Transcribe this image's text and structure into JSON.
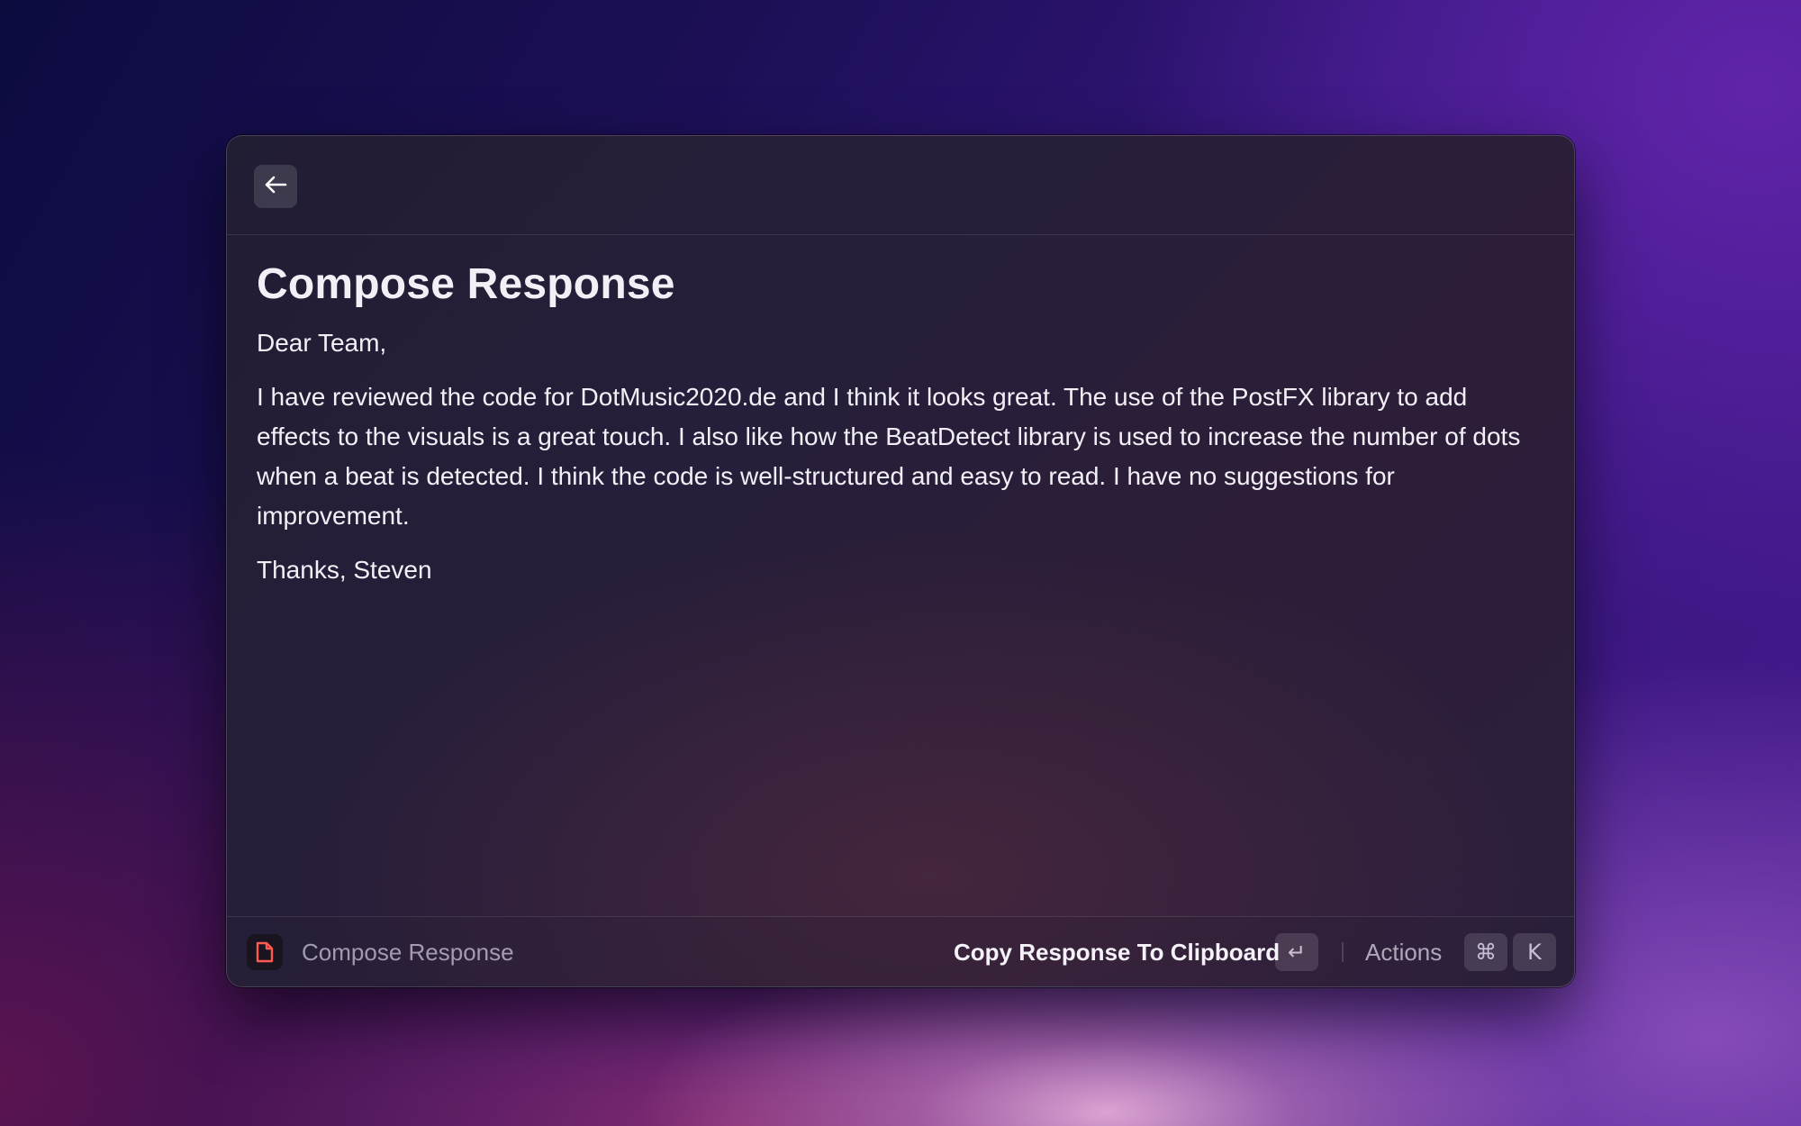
{
  "header": {
    "back_icon": "arrow-left-icon"
  },
  "content": {
    "title": "Compose Response",
    "greeting": "Dear Team,",
    "body": "I have reviewed the code for DotMusic2020.de and I think it looks great. The use of the PostFX library to add effects to the visuals is a great touch. I also like how the BeatDetect library is used to increase the number of dots when a beat is detected. I think the code is well-structured and easy to read. I have no suggestions for improvement.",
    "signoff": "Thanks, Steven"
  },
  "footer": {
    "app_icon": "document-icon",
    "title": "Compose Response",
    "primary_action": "Copy Response To Clipboard",
    "enter_key": "↵",
    "actions_label": "Actions",
    "cmd_key": "⌘",
    "k_key": "K",
    "icon_color": "#ff5a4f"
  }
}
